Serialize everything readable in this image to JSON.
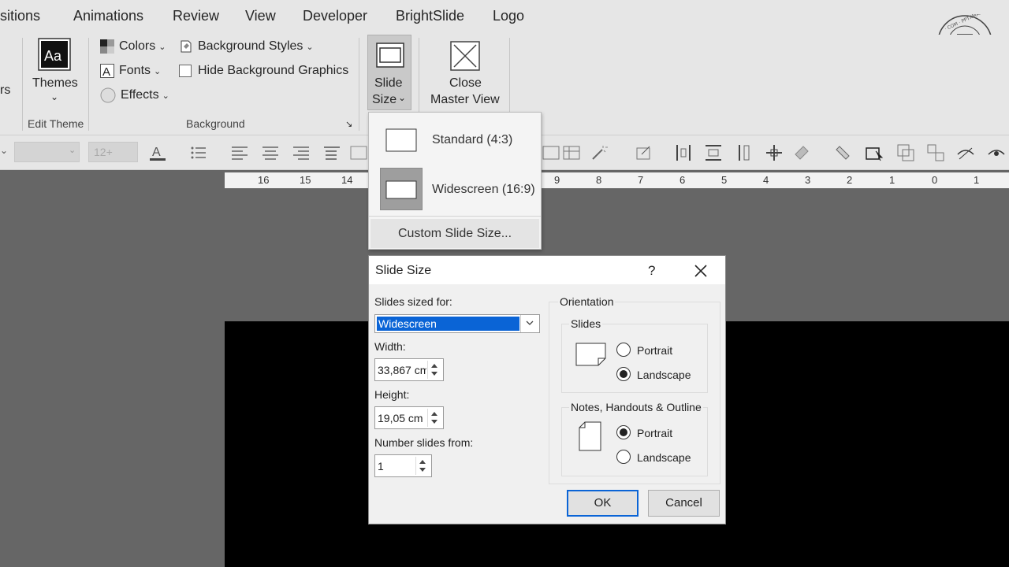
{
  "tabs": [
    "sitions",
    "Animations",
    "Review",
    "View",
    "Developer",
    "BrightSlide",
    "Logo"
  ],
  "ribbon": {
    "cut_label": "rs",
    "themes_label": "Themes",
    "edit_theme_group": "Edit Theme",
    "colors": "Colors",
    "fonts": "Fonts",
    "effects": "Effects",
    "background_styles": "Background Styles",
    "hide_background_graphics": "Hide Background Graphics",
    "background_group": "Background",
    "slide_size_line1": "Slide",
    "slide_size_line2": "Size",
    "close_master_line1": "Close",
    "close_master_line2": "Master View"
  },
  "toolbar": {
    "font_size_placeholder": "12+"
  },
  "ruler": [
    "16",
    "15",
    "14",
    "9",
    "8",
    "7",
    "6",
    "5",
    "4",
    "3",
    "2",
    "1",
    "0",
    "1"
  ],
  "menu": {
    "standard": "Standard (4:3)",
    "widescreen": "Widescreen (16:9)",
    "custom": "Custom Slide Size..."
  },
  "dialog": {
    "title": "Slide Size",
    "help": "?",
    "slides_sized_for_label": "Slides sized for:",
    "slides_sized_for_value": "Widescreen",
    "width_label": "Width:",
    "width_value": "33,867 cm",
    "height_label": "Height:",
    "height_value": "19,05 cm",
    "number_from_label": "Number slides from:",
    "number_from_value": "1",
    "orientation_label": "Orientation",
    "slides_label": "Slides",
    "slides_portrait": "Portrait",
    "slides_landscape": "Landscape",
    "notes_label": "Notes, Handouts & Outline",
    "notes_portrait": "Portrait",
    "notes_landscape": "Landscape",
    "ok": "OK",
    "cancel": "Cancel"
  },
  "colors": {
    "selection": "#0a64d6",
    "ribbon_bg": "#e6e6e6",
    "workspace": "#666666"
  }
}
